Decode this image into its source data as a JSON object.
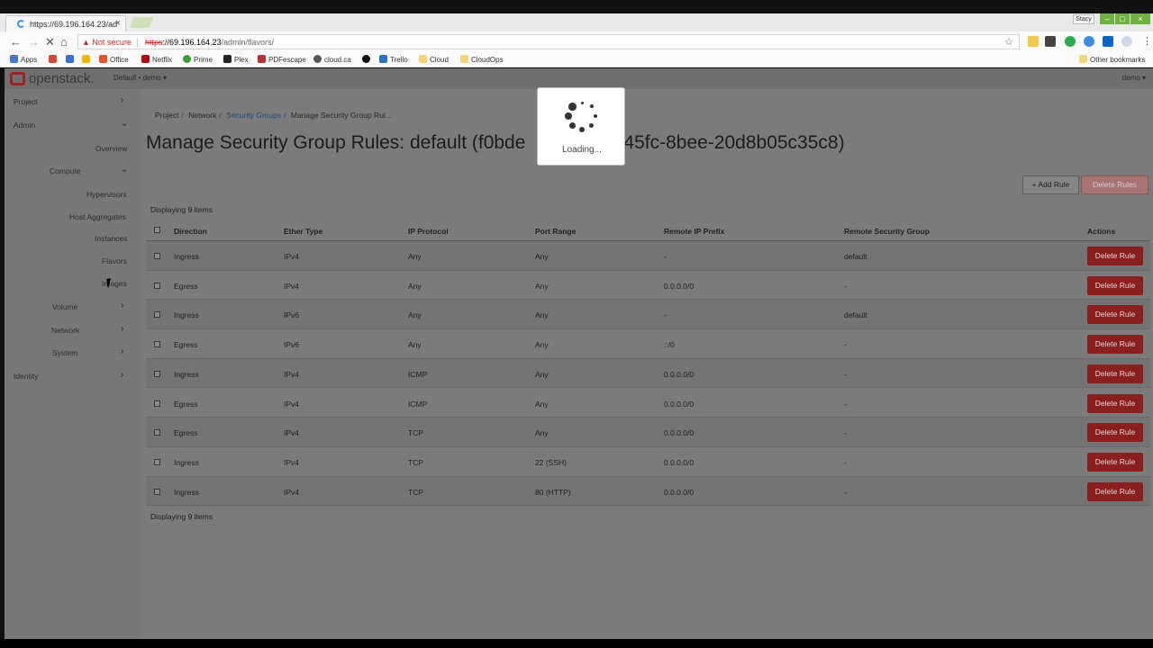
{
  "browser": {
    "tab_title": "https://69.196.164.23/ad",
    "profile": "Stacy",
    "not_secure": "Not secure",
    "url_scheme": "https",
    "url_rest": "://69.196.164.23",
    "url_path": "/admin/flavors/",
    "bookmarks": [
      "Apps",
      "Office",
      "Netflix",
      "Prime",
      "Plex",
      "PDFescape",
      "cloud.ca",
      "Trello",
      "Cloud",
      "CloudOps"
    ],
    "other_bookmarks": "Other bookmarks"
  },
  "header": {
    "logo": "openstack.",
    "domain": "Default • demo ▾",
    "user": "demo ▾"
  },
  "sidebar": {
    "project": "Project",
    "admin": "Admin",
    "overview": "Overview",
    "compute": "Compute",
    "hypervisors": "Hypervisors",
    "host_aggregates": "Host Aggregates",
    "instances": "Instances",
    "flavors": "Flavors",
    "images": "Images",
    "volume": "Volume",
    "network": "Network",
    "system": "System",
    "identity": "Identity"
  },
  "breadcrumb": {
    "project": "Project",
    "network": "Network",
    "security_groups": "Security Groups",
    "current": "Manage Security Group Rul..."
  },
  "main": {
    "title_left": "Manage Security Group Rules: default (f0bde",
    "title_right": "-45fc-8bee-20d8b05c35c8)",
    "add_rule": "+ Add Rule",
    "delete_rules": "Delete Rules",
    "count_top": "Displaying 9 items",
    "count_bottom": "Displaying 9 items",
    "delete_rule_label": "Delete Rule"
  },
  "table": {
    "headers": [
      "Direction",
      "Ether Type",
      "IP Protocol",
      "Port Range",
      "Remote IP Prefix",
      "Remote Security Group",
      "Actions"
    ],
    "rows": [
      [
        "Ingress",
        "IPv4",
        "Any",
        "Any",
        "-",
        "default"
      ],
      [
        "Egress",
        "IPv4",
        "Any",
        "Any",
        "0.0.0.0/0",
        "-"
      ],
      [
        "Ingress",
        "IPv6",
        "Any",
        "Any",
        "-",
        "default"
      ],
      [
        "Egress",
        "IPv6",
        "Any",
        "Any",
        "::/0",
        "-"
      ],
      [
        "Ingress",
        "IPv4",
        "ICMP",
        "Any",
        "0.0.0.0/0",
        "-"
      ],
      [
        "Egress",
        "IPv4",
        "ICMP",
        "Any",
        "0.0.0.0/0",
        "-"
      ],
      [
        "Egress",
        "IPv4",
        "TCP",
        "Any",
        "0.0.0.0/0",
        "-"
      ],
      [
        "Ingress",
        "IPv4",
        "TCP",
        "22 (SSH)",
        "0.0.0.0/0",
        "-"
      ],
      [
        "Ingress",
        "IPv4",
        "TCP",
        "80 (HTTP)",
        "0.0.0.0/0",
        "-"
      ]
    ]
  },
  "modal": {
    "loading": "Loading..."
  }
}
